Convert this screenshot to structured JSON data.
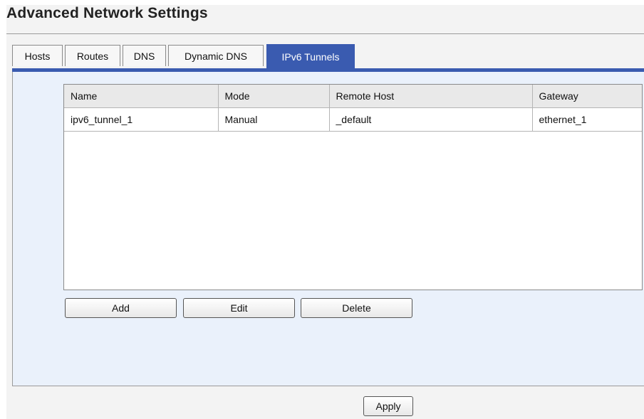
{
  "page": {
    "title": "Advanced Network Settings"
  },
  "tabs": [
    {
      "label": "Hosts",
      "active": false
    },
    {
      "label": "Routes",
      "active": false
    },
    {
      "label": "DNS",
      "active": false
    },
    {
      "label": "Dynamic DNS",
      "active": false
    },
    {
      "label": "IPv6 Tunnels",
      "active": true
    }
  ],
  "colors": {
    "accent": "#3a5bb0",
    "panel_bg": "#eaf1fb"
  },
  "table": {
    "columns": [
      "Name",
      "Mode",
      "Remote Host",
      "Gateway"
    ],
    "rows": [
      [
        "ipv6_tunnel_1",
        "Manual",
        "_default",
        "ethernet_1"
      ]
    ]
  },
  "actions": {
    "add": "Add",
    "edit": "Edit",
    "delete": "Delete"
  },
  "footer": {
    "apply": "Apply"
  }
}
